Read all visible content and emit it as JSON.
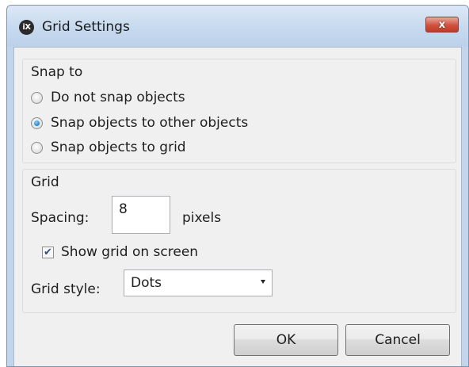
{
  "window": {
    "title": "Grid Settings",
    "app_icon_text": "iX",
    "close_glyph": "x"
  },
  "snap": {
    "group_label": "Snap to",
    "options": [
      {
        "label": "Do not snap objects",
        "checked": false
      },
      {
        "label": "Snap objects to other objects",
        "checked": true
      },
      {
        "label": "Snap objects to grid",
        "checked": false
      }
    ]
  },
  "grid": {
    "group_label": "Grid",
    "spacing_label": "Spacing:",
    "spacing_value": "8",
    "spacing_unit": "pixels",
    "show_grid_label": "Show grid on screen",
    "show_grid_checked": true,
    "style_label": "Grid style:",
    "style_value": "Dots"
  },
  "buttons": {
    "ok": "OK",
    "cancel": "Cancel"
  },
  "icons": {
    "app": "ix-app-icon",
    "close": "close-icon",
    "radio_checked": "radio-selected",
    "checkbox_checked": "checkmark",
    "dropdown": "chevron-down-icon"
  }
}
